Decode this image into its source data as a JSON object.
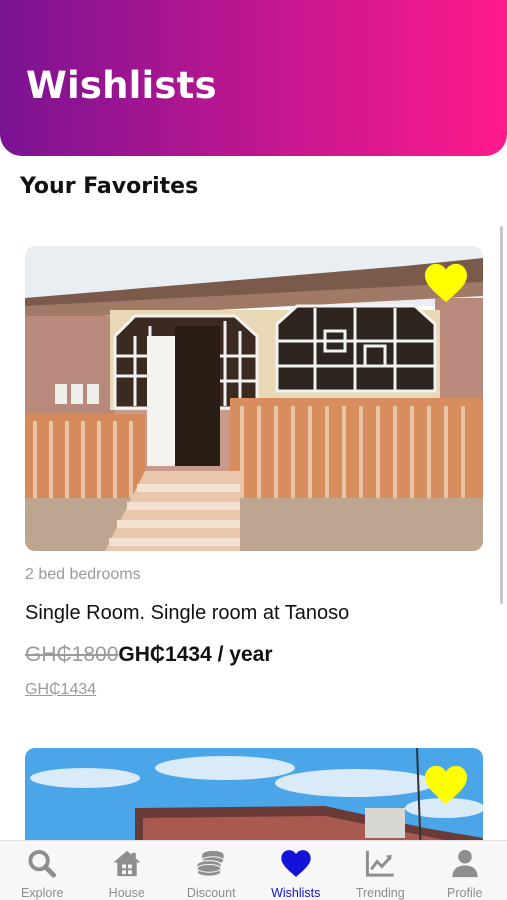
{
  "header": {
    "title": "Wishlists"
  },
  "section": {
    "title": "Your Favorites"
  },
  "listings": [
    {
      "bedrooms": "2 bed  bedrooms",
      "title": "Single Room. Single room at Tanoso",
      "old_price": "GH₵1800",
      "new_price": "GH₵1434 / year",
      "sub_price": "GH₵1434",
      "favorited": true
    },
    {
      "favorited": true
    }
  ],
  "tabs": [
    {
      "label": "Explore",
      "icon": "search-icon",
      "active": false
    },
    {
      "label": "House",
      "icon": "house-icon",
      "active": false
    },
    {
      "label": "Discount",
      "icon": "coins-icon",
      "active": false
    },
    {
      "label": "Wishlists",
      "icon": "heart-icon",
      "active": true
    },
    {
      "label": "Trending",
      "icon": "trending-chart-icon",
      "active": false
    },
    {
      "label": "Profile",
      "icon": "person-icon",
      "active": false
    }
  ],
  "colors": {
    "header_gradient_start": "#7a1392",
    "header_gradient_end": "#ff1a8c",
    "favorite_heart": "#ffff00",
    "active_tab": "#1212d8",
    "inactive_tab": "#8e8e8e"
  }
}
